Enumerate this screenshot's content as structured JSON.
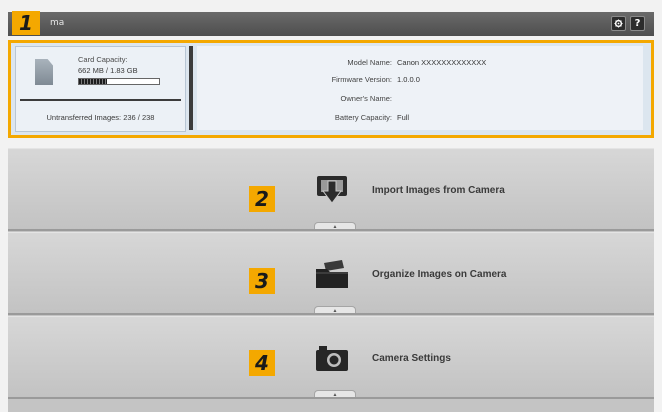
{
  "window": {
    "title": "ma",
    "settings_icon": "gear-icon",
    "help_label": "?"
  },
  "callouts": [
    "1",
    "2",
    "3",
    "4"
  ],
  "card": {
    "capacity_label": "Card Capacity:",
    "capacity_value": "662 MB / 1.83 GB",
    "used_fraction": 0.35,
    "untransferred": "Untransferred Images: 236 / 238"
  },
  "camera_info": [
    {
      "label": "Model Name:",
      "value": "Canon XXXXXXXXXXXXX"
    },
    {
      "label": "Firmware Version:",
      "value": "1.0.0.0"
    },
    {
      "label": "Owner's Name:",
      "value": ""
    },
    {
      "label": "Battery Capacity:",
      "value": "Full"
    }
  ],
  "actions": [
    {
      "label": "Import Images from Camera",
      "icon": "import-icon"
    },
    {
      "label": "Organize Images on Camera",
      "icon": "folder-icon"
    },
    {
      "label": "Camera Settings",
      "icon": "camera-icon"
    }
  ],
  "colors": {
    "callout": "#f4a800",
    "titlebar": "#555555",
    "panel": "#dce6ef"
  }
}
